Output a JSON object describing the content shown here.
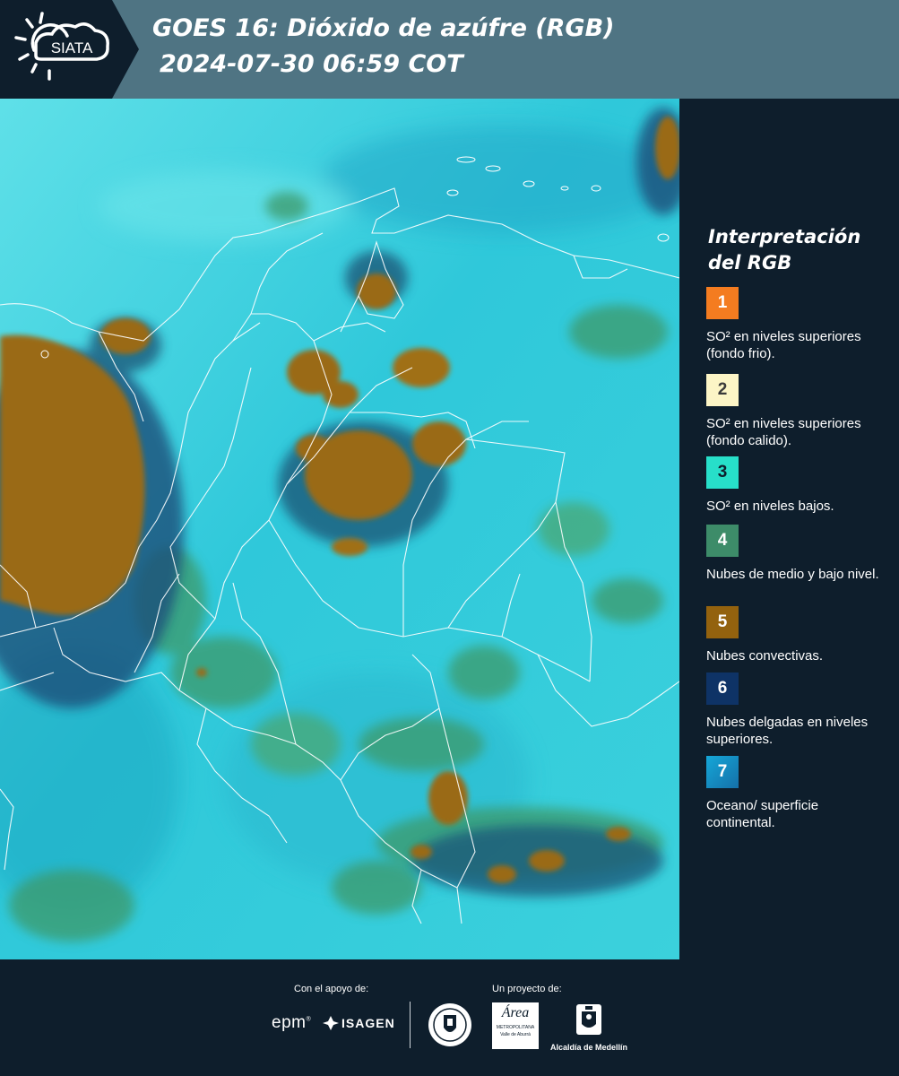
{
  "header": {
    "logo_text": "SIATA",
    "title_line1": "GOES 16: Dióxido de azúfre (RGB)",
    "title_line2": "2024-07-30 06:59 COT"
  },
  "legend": {
    "title_line1": "Interpretación",
    "title_line2": "del RGB",
    "items": [
      {
        "number": "1",
        "label": "SO² en niveles superiores (fondo frio).",
        "color": "#f47c20",
        "text_color": "#ffffff"
      },
      {
        "number": "2",
        "label": "SO² en niveles superiores (fondo calido).",
        "color": "#fcf5c6",
        "text_color": "#3a3a3a"
      },
      {
        "number": "3",
        "label": "SO² en niveles bajos.",
        "color": "#27dfc9",
        "text_color": "#0e1e2c"
      },
      {
        "number": "4",
        "label": "Nubes de medio y bajo nivel.",
        "color": "#3d8c69",
        "text_color": "#ffffff"
      },
      {
        "number": "5",
        "label": "Nubes convectivas.",
        "color": "#93620e",
        "text_color": "#ffffff"
      },
      {
        "number": "6",
        "label": "Nubes delgadas en niveles superiores.",
        "color": "#0e3366",
        "text_color": "#ffffff"
      },
      {
        "number": "7",
        "label": "Oceano/ superficie continental.",
        "color": "#1f8ec4",
        "text_color": "#ffffff"
      }
    ]
  },
  "footer": {
    "support_label": "Con el apoyo de:",
    "project_label": "Un proyecto de:",
    "epm_text": "epm",
    "isagen_text": "ISAGEN",
    "area_text": "Área",
    "area_sub1": "METROPOLITANA",
    "area_sub2": "Valle de Aburrá",
    "alcaldia_text": "Alcaldía de Medellín"
  },
  "map": {
    "colors": {
      "ocean": "#2cc9dc",
      "convective": "#9a6a17",
      "low_clouds": "#3c9a6a",
      "thin_clouds": "#1b4f7a",
      "borders": "#ffffff"
    }
  }
}
